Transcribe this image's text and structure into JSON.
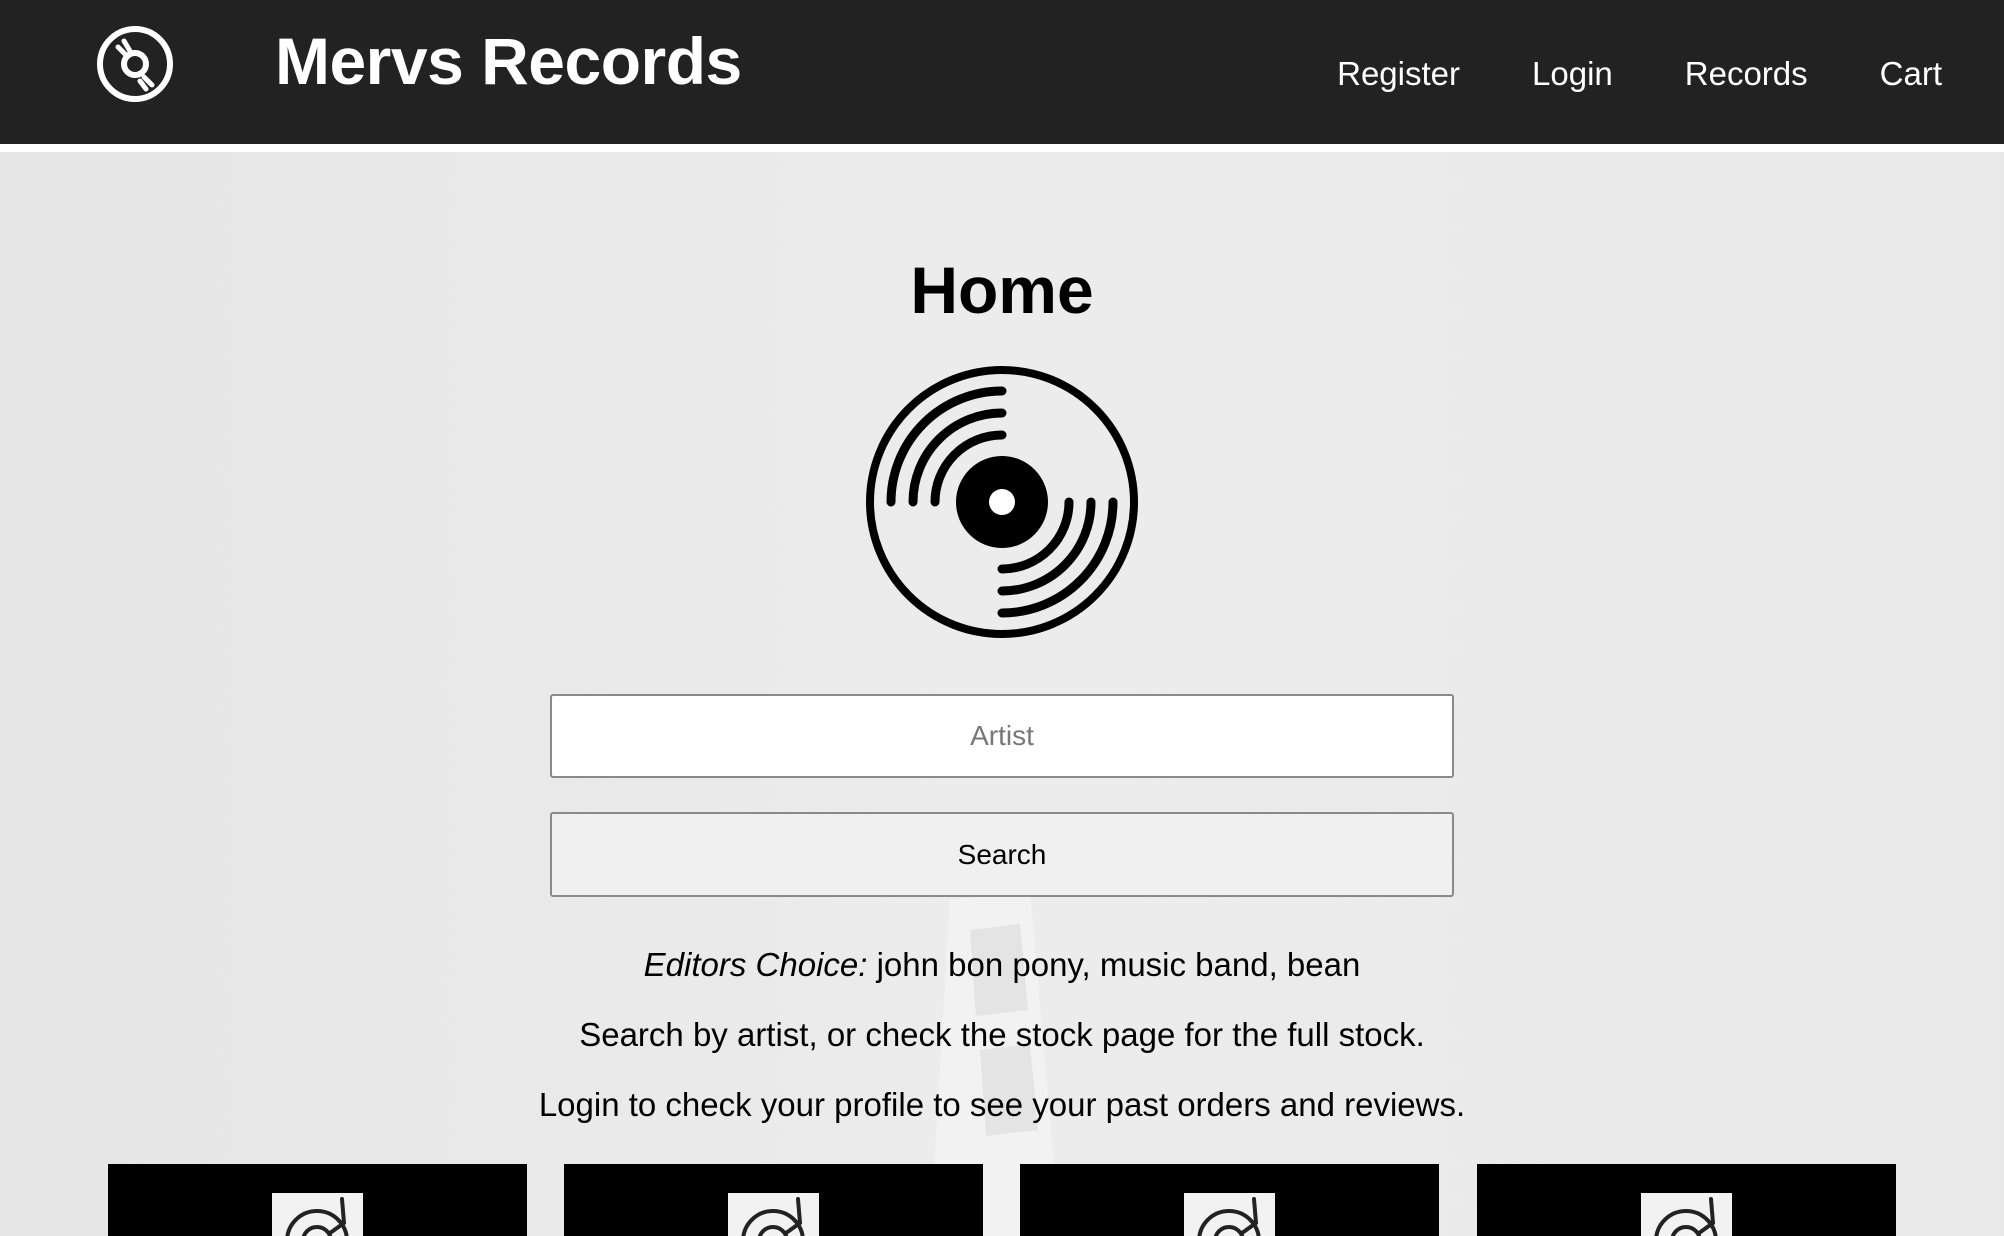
{
  "header": {
    "brand": "Mervs Records",
    "logo_icon": "vinyl-record-icon",
    "nav": [
      {
        "label": "Register"
      },
      {
        "label": "Login"
      },
      {
        "label": "Records"
      },
      {
        "label": "Cart"
      }
    ]
  },
  "main": {
    "title": "Home",
    "hero_icon": "vinyl-record-icon",
    "search": {
      "placeholder": "Artist",
      "value": "",
      "button_label": "Search"
    },
    "editors_choice": {
      "label": "Editors Choice:",
      "artists": " john bon pony, music band, bean"
    },
    "info_search": "Search by artist, or check the stock page for the full stock.",
    "info_login": "Login to check your profile to see your past orders and reviews."
  },
  "cards": [
    {
      "thumb_icon": "turntable-icon"
    },
    {
      "thumb_icon": "turntable-icon"
    },
    {
      "thumb_icon": "turntable-icon"
    },
    {
      "thumb_icon": "turntable-icon"
    }
  ],
  "colors": {
    "navbar": "#222222",
    "navbar_text": "#ffffff",
    "page_background": "#eaeaea",
    "card_background": "#000000"
  }
}
